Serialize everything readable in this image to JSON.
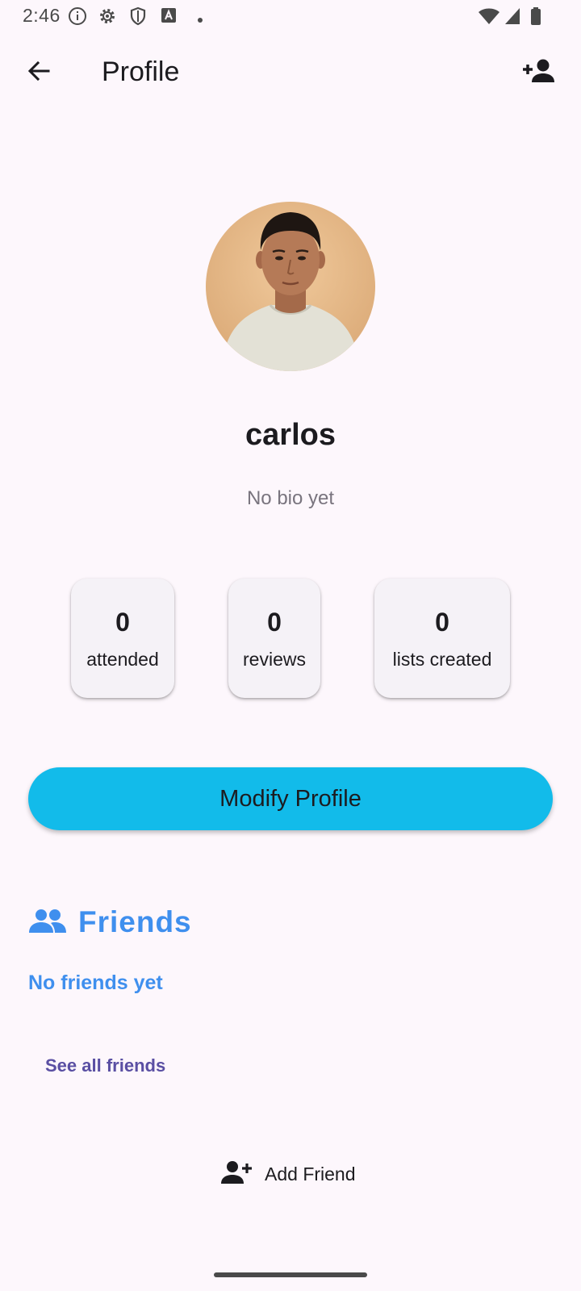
{
  "status_bar": {
    "time": "2:46",
    "icons": [
      "info-icon",
      "gear-icon",
      "shield-icon",
      "text-a-icon",
      "dot-icon",
      "wifi-icon",
      "signal-icon",
      "battery-icon"
    ]
  },
  "app_bar": {
    "title": "Profile",
    "back_icon": "arrow-back-icon",
    "action_icon": "person-add-icon"
  },
  "profile": {
    "username": "carlos",
    "bio": "No bio yet"
  },
  "stats": [
    {
      "value": "0",
      "label": "attended"
    },
    {
      "value": "0",
      "label": "reviews"
    },
    {
      "value": "0",
      "label": "lists created"
    }
  ],
  "modify_button": {
    "label": "Modify Profile"
  },
  "friends": {
    "title": "Friends",
    "empty_text": "No friends yet",
    "see_all_label": "See all friends",
    "add_friend_label": "Add Friend"
  },
  "colors": {
    "background": "#fdf7fc",
    "accent": "#12bbea",
    "friends_blue": "#3f8fee",
    "link_purple": "#5a4fa3",
    "card": "#f5f2f7"
  }
}
